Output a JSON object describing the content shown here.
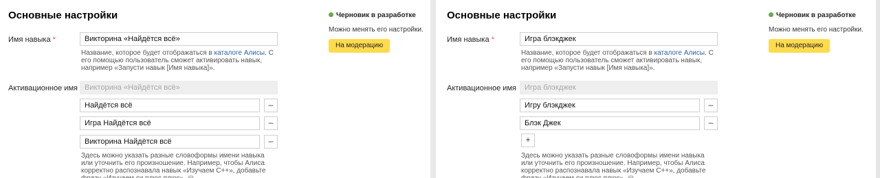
{
  "colors": {
    "accent_button": "#ffdb4d",
    "status_dot": "#6aa84f",
    "link": "#2a5fa8",
    "required": "#f0563d"
  },
  "icons": {
    "minus": "minus-icon",
    "plus": "plus-icon",
    "help": "help-circle-icon",
    "status": "status-dot-icon"
  },
  "left": {
    "title": "Основные настройки",
    "name_label": "Имя навыка",
    "required_mark": "*",
    "name_value": "Викторина «Найдётся всё»",
    "hint_pre": "Название, которое будет отображаться в ",
    "hint_link": "каталоге Алисы",
    "hint_post": ". С его помощью пользователь сможет активировать навык, например «Запусти навык [Имя навыка]».",
    "activation_label": "Активационное имя",
    "activation_value": "Викторина «Найдётся всё»",
    "activation_names": [
      "Найдётся всё",
      "Игра Найдётся всё",
      "Викторина Найдётся всё"
    ],
    "minus_symbol": "–",
    "wordforms_hint": "Здесь можно указать разные словоформы имени навыка или уточнить его произношение. Например, чтобы Алиса корректно распознавала навык «Изучаем С++», добавьте фразу «Изучаем си плюс плюс».",
    "help_symbol": "?",
    "status": "Черновик в разработке",
    "status_note": "Можно менять его настройки.",
    "moderation_button": "На модерацию"
  },
  "right": {
    "title": "Основные настройки",
    "name_label": "Имя навыка",
    "required_mark": "*",
    "name_value": "Игра блэкджек",
    "hint_pre": "Название, которое будет отображаться в ",
    "hint_link": "каталоге Алисы",
    "hint_post": ". С его помощью пользователь сможет активировать навык, например «Запусти навык [Имя навыка]».",
    "activation_label": "Активационное имя",
    "activation_value": "Игра блэкджек",
    "activation_names": [
      "Игру блэкджек",
      "Блэк Джек"
    ],
    "minus_symbol": "–",
    "plus_symbol": "+",
    "wordforms_hint": "Здесь можно указать разные словоформы имени навыка или уточнить его произношение. Например, чтобы Алиса корректно распознавала навык «Изучаем С++», добавьте фразу «Изучаем си плюс плюс».",
    "help_symbol": "?",
    "status": "Черновик в разработке",
    "status_note": "Можно менять его настройки.",
    "moderation_button": "На модерацию"
  }
}
